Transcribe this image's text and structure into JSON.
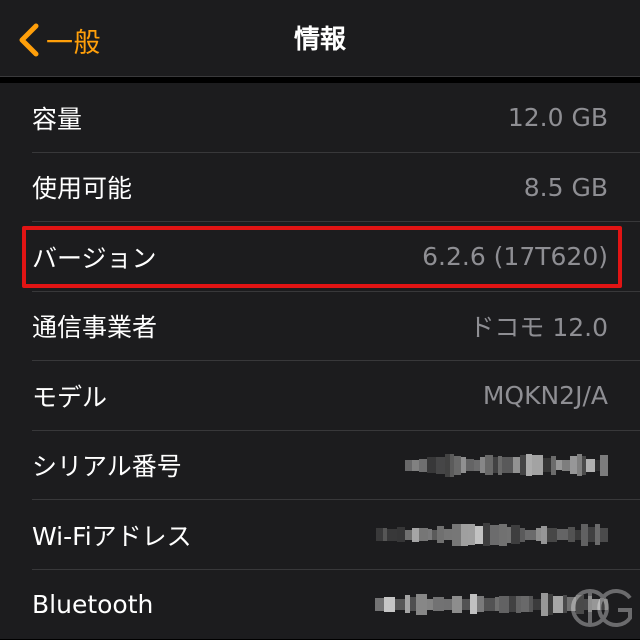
{
  "navbar": {
    "back_label": "一般",
    "title": "情報"
  },
  "rows": [
    {
      "label": "容量",
      "value": "12.0 GB"
    },
    {
      "label": "使用可能",
      "value": "8.5 GB"
    },
    {
      "label": "バージョン",
      "value": "6.2.6 (17T620)"
    },
    {
      "label": "通信事業者",
      "value": "ドコモ 12.0"
    },
    {
      "label": "モデル",
      "value": "MQKN2J/A"
    },
    {
      "label": "シリアル番号",
      "value": ""
    },
    {
      "label": "Wi-Fiアドレス",
      "value": ""
    },
    {
      "label": "Bluetooth",
      "value": ""
    }
  ],
  "colors": {
    "accent": "#ff9f0a",
    "highlight_border": "#e11414",
    "cell_background": "#1c1c1e",
    "value_text": "#8e8e93"
  },
  "icons": {
    "back": "chevron-left-icon",
    "watermark": "dg-logo"
  }
}
